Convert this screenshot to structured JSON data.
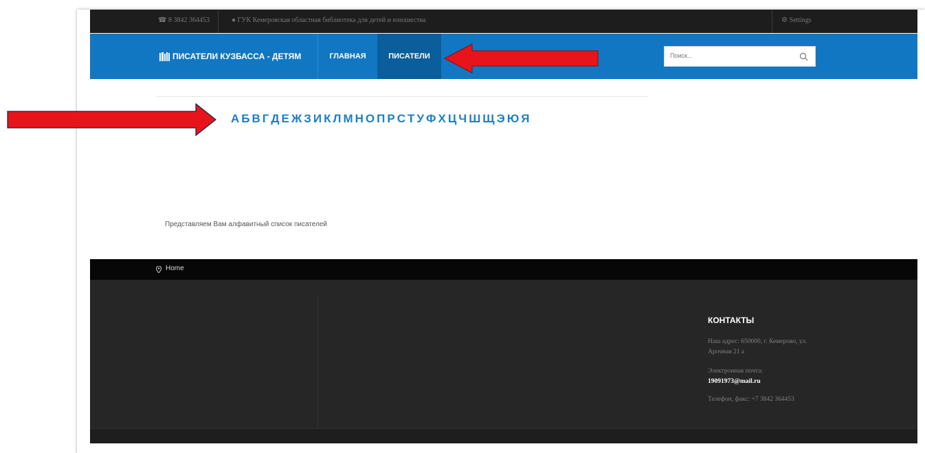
{
  "topbar": {
    "phone": "☎ 8 3842 364453",
    "library": "● ГУК Кемеровская областная библиотека для детей и юношества",
    "settings": "⚙ Settings"
  },
  "nav": {
    "logo": "ПИСАТЕЛИ КУЗБАССА - ДЕТЯМ",
    "items": [
      "ГЛАВНАЯ",
      "ПИСАТЕЛИ"
    ]
  },
  "search": {
    "placeholder": "Поиск..."
  },
  "alphabet": [
    "А",
    "Б",
    "В",
    "Г",
    "Д",
    "Е",
    "Ж",
    "З",
    "И",
    "К",
    "Л",
    "М",
    "Н",
    "О",
    "П",
    "Р",
    "С",
    "Т",
    "У",
    "Ф",
    "Х",
    "Ц",
    "Ч",
    "Ш",
    "Щ",
    "Э",
    "Ю",
    "Я"
  ],
  "intro": "Представляем Вам алфавитный список писателей",
  "breadcrumb": {
    "home": "Home"
  },
  "footer": {
    "contacts_title": "КОНТАКТЫ",
    "address": "Наш адрес: 650000, г. Кемерово, ул. Арочная 21 а",
    "email_label": "Электронная почта:",
    "email": "19091973@mail.ru",
    "phone": "Телефон, факс: +7 3842 364453"
  },
  "colors": {
    "nav": "#1177c2",
    "nav_active": "#0a5e9c",
    "accent": "#1d7fc4",
    "arrow": "#e8141b"
  }
}
